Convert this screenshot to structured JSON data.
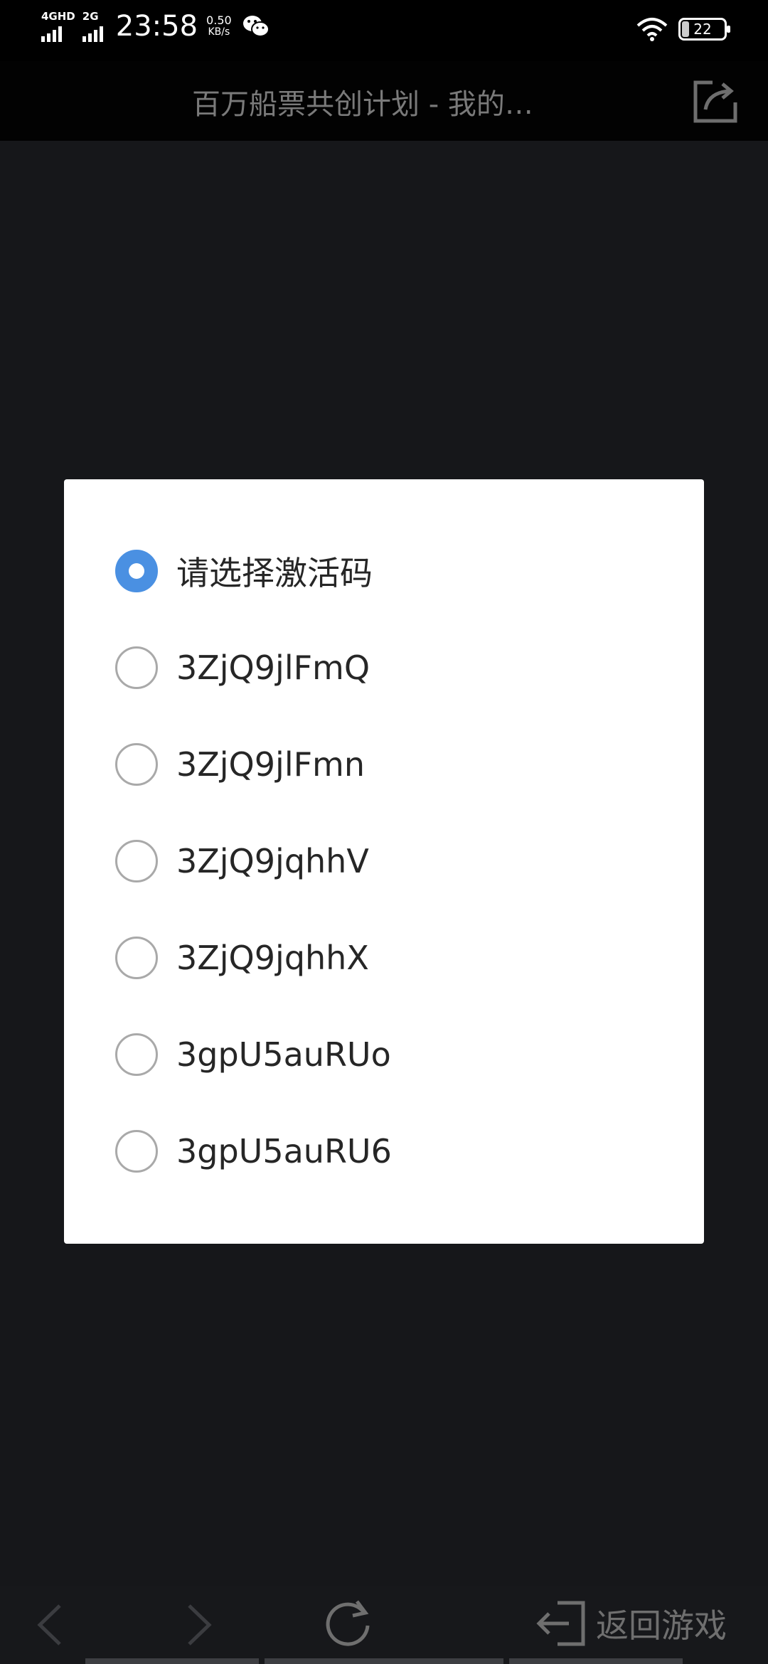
{
  "status_bar": {
    "network_1": "4GHD",
    "network_2": "2G",
    "time": "23:58",
    "speed_value": "0.50",
    "speed_unit": "KB/s",
    "battery": "22"
  },
  "header": {
    "title": "百万船票共创计划 - 我的…"
  },
  "dialog": {
    "options": [
      {
        "label": "请选择激活码",
        "selected": true
      },
      {
        "label": "3ZjQ9jlFmQ",
        "selected": false
      },
      {
        "label": "3ZjQ9jlFmn",
        "selected": false
      },
      {
        "label": "3ZjQ9jqhhV",
        "selected": false
      },
      {
        "label": "3ZjQ9jqhhX",
        "selected": false
      },
      {
        "label": "3gpU5auRUo",
        "selected": false
      },
      {
        "label": "3gpU5auRU6",
        "selected": false
      }
    ]
  },
  "bottom_bar": {
    "return_label": "返回游戏"
  },
  "colors": {
    "accent": "#4a90e2",
    "background": "#16171a",
    "dialog": "#ffffff"
  }
}
